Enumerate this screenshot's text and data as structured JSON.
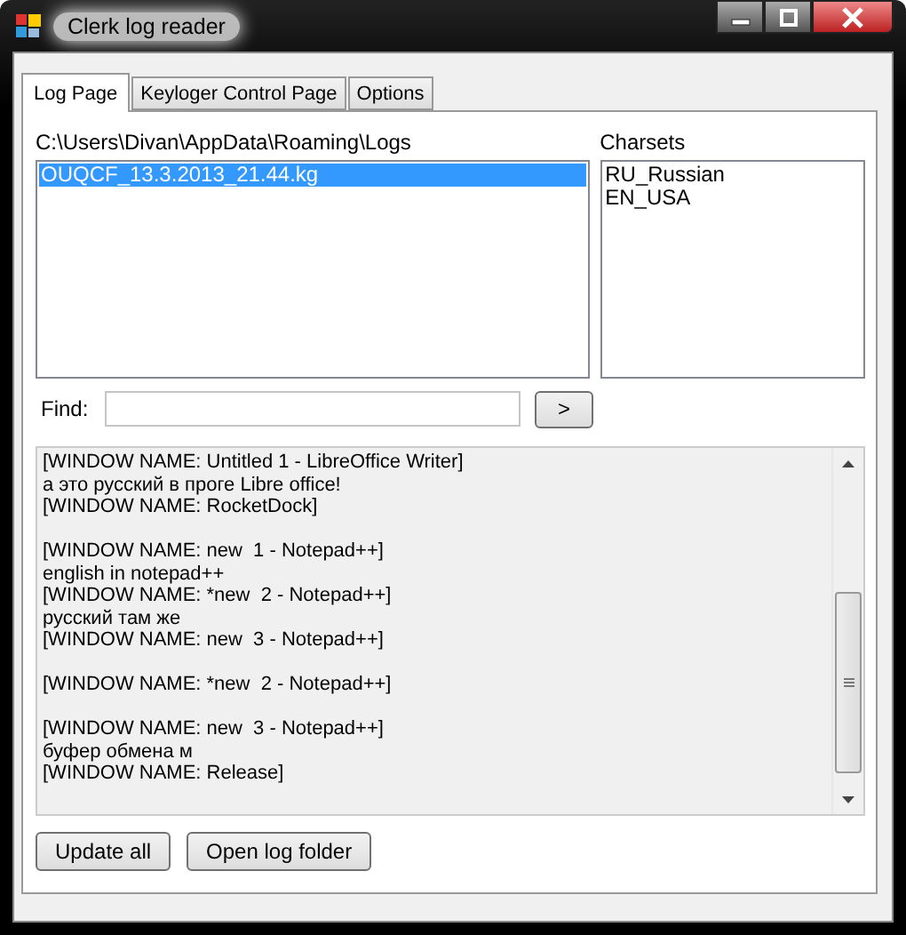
{
  "window": {
    "title": "Clerk log reader"
  },
  "tabs": [
    {
      "label": "Log Page",
      "selected": true
    },
    {
      "label": "Keyloger Control Page",
      "selected": false
    },
    {
      "label": "Options",
      "selected": false
    }
  ],
  "logs": {
    "path": "C:\\Users\\Divan\\AppData\\Roaming\\Logs",
    "items": [
      {
        "label": "OUQCF_13.3.2013_21.44.kg",
        "selected": true
      }
    ]
  },
  "charsets": {
    "label": "Charsets",
    "items": [
      {
        "label": "RU_Russian",
        "selected": false
      },
      {
        "label": "EN_USA",
        "selected": false
      }
    ]
  },
  "find": {
    "label": "Find:",
    "button": ">"
  },
  "log_paragraphs": [
    {
      "lines": [
        "[WINDOW NAME: Untitled 1 - LibreOffice Writer]",
        "а это русский в проге Libre office!",
        "[WINDOW NAME: RocketDock]"
      ]
    },
    {
      "lines": [
        "[WINDOW NAME: new  1 - Notepad++]",
        "english in notepad++",
        "[WINDOW NAME: *new  2 - Notepad++]",
        "русский там же",
        "[WINDOW NAME: new  3 - Notepad++]"
      ]
    },
    {
      "lines": [
        "[WINDOW NAME: *new  2 - Notepad++]"
      ]
    },
    {
      "lines": [
        "[WINDOW NAME: new  3 - Notepad++]",
        "буфер обмена м",
        "[WINDOW NAME: Release]"
      ]
    }
  ],
  "buttons": [
    "Update all",
    "Open log folder"
  ]
}
